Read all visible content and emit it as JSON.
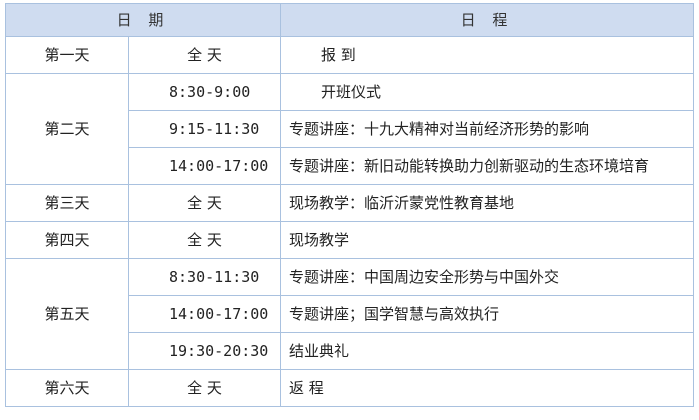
{
  "header": {
    "date": "日 期",
    "program": "日 程"
  },
  "rows": [
    {
      "day": "第一天",
      "time": "全 天",
      "program": "报 到"
    },
    {
      "day": "第二天",
      "time": "8:30-9:00",
      "program": "开班仪式"
    },
    {
      "day": "",
      "time": "9:15-11:30",
      "program": "专题讲座：十九大精神对当前经济形势的影响"
    },
    {
      "day": "",
      "time": "14:00-17:00",
      "program": "专题讲座：新旧动能转换助力创新驱动的生态环境培育"
    },
    {
      "day": "第三天",
      "time": "全 天",
      "program": "现场教学：临沂沂蒙党性教育基地"
    },
    {
      "day": "第四天",
      "time": "全 天",
      "program": "现场教学"
    },
    {
      "day": "第五天",
      "time": "8:30-11:30",
      "program": "专题讲座：中国周边安全形势与中国外交"
    },
    {
      "day": "",
      "time": "14:00-17:00",
      "program": "专题讲座；国学智慧与高效执行"
    },
    {
      "day": "",
      "time": "19:30-20:30",
      "program": "结业典礼"
    },
    {
      "day": "第六天",
      "time": "全 天",
      "program": "返 程"
    }
  ]
}
